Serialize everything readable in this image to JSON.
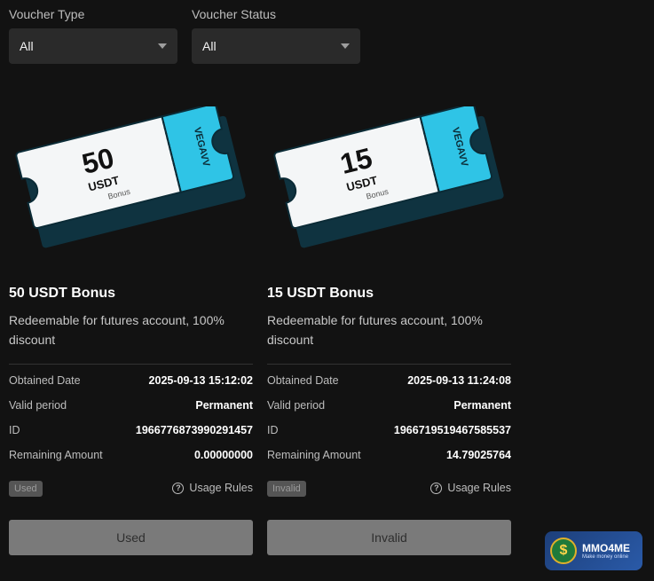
{
  "filters": {
    "type": {
      "label": "Voucher Type",
      "value": "All"
    },
    "status": {
      "label": "Voucher Status",
      "value": "All"
    }
  },
  "vouchers": [
    {
      "amount": "50",
      "currency": "USDT",
      "sub": "Bonus",
      "brand": "VEGAVV",
      "title": "50 USDT Bonus",
      "description": "Redeemable for futures account, 100% discount",
      "obtained_label": "Obtained Date",
      "obtained_value": "2025-09-13 15:12:02",
      "valid_label": "Valid period",
      "valid_value": "Permanent",
      "id_label": "ID",
      "id_value": "1966776873990291457",
      "remaining_label": "Remaining Amount",
      "remaining_value": "0.00000000",
      "status_badge": "Used",
      "rules_label": "Usage Rules",
      "button_label": "Used"
    },
    {
      "amount": "15",
      "currency": "USDT",
      "sub": "Bonus",
      "brand": "VEGAVV",
      "title": "15 USDT Bonus",
      "description": "Redeemable for futures account, 100% discount",
      "obtained_label": "Obtained Date",
      "obtained_value": "2025-09-13 11:24:08",
      "valid_label": "Valid period",
      "valid_value": "Permanent",
      "id_label": "ID",
      "id_value": "1966719519467585537",
      "remaining_label": "Remaining Amount",
      "remaining_value": "14.79025764",
      "status_badge": "Invalid",
      "rules_label": "Usage Rules",
      "button_label": "Invalid"
    }
  ],
  "watermark": {
    "coin": "$",
    "name": "MMO4ME",
    "tagline": "Make money online"
  },
  "colors": {
    "background": "#121212",
    "ticket_accent": "#2fc4e6",
    "ticket_face": "#f4f6f7"
  }
}
